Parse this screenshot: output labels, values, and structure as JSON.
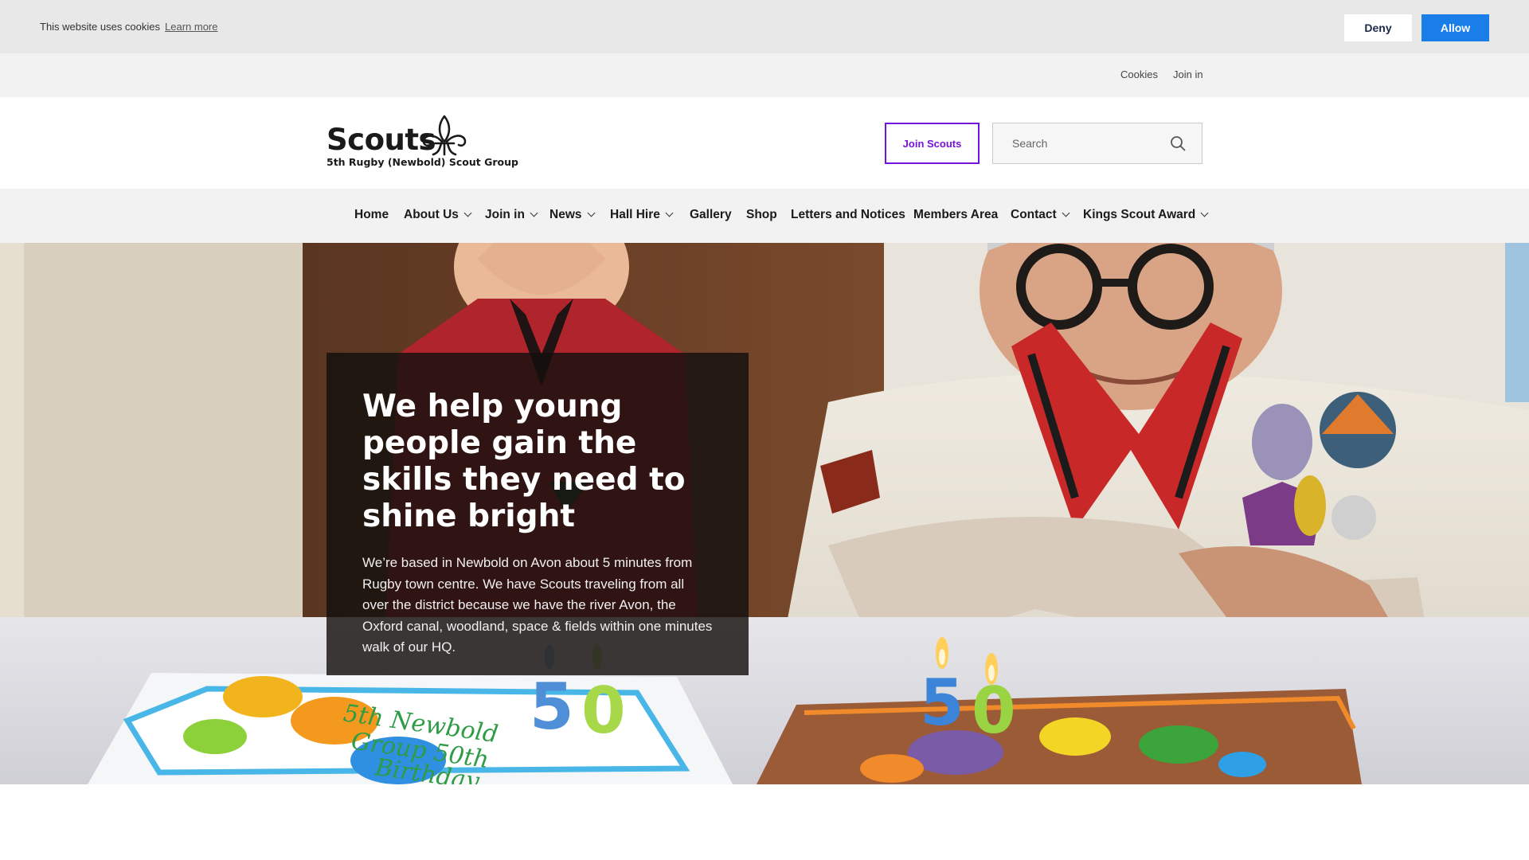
{
  "cookie_bar": {
    "message": "This website uses cookies",
    "learn_more": "Learn more",
    "deny_label": "Deny",
    "allow_label": "Allow",
    "allow_color": "#1a7ee8"
  },
  "utility_nav": {
    "items": [
      "Cookies",
      "Join in"
    ]
  },
  "header": {
    "logo_word": "Scouts",
    "logo_subtitle": "5th Rugby (Newbold) Scout Group",
    "logo_icon": "fleur-de-lis-icon",
    "join_button": "Join Scouts",
    "brand_color": "#7413dc",
    "search": {
      "placeholder": "Search",
      "value": "",
      "icon": "search-icon"
    }
  },
  "main_nav": {
    "items": [
      {
        "label": "Home",
        "dropdown": false
      },
      {
        "label": "About Us",
        "dropdown": true
      },
      {
        "label": "Join in",
        "dropdown": true
      },
      {
        "label": "News",
        "dropdown": true
      },
      {
        "label": "Hall Hire",
        "dropdown": true
      },
      {
        "label": "Gallery",
        "dropdown": false
      },
      {
        "label": "Shop",
        "dropdown": false
      },
      {
        "label": "Letters and Notices",
        "dropdown": false
      },
      {
        "label": "Members Area",
        "dropdown": false
      },
      {
        "label": "Contact",
        "dropdown": true
      },
      {
        "label": "Kings Scout Award",
        "dropdown": true
      }
    ]
  },
  "hero": {
    "title": "We help young people gain the skills they need to shine bright",
    "text": "We’re based in Newbold on Avon about 5 minutes from Rugby town centre. We have Scouts traveling from all over the district because we have the river Avon, the Oxford canal, woodland, space & fields within one minutes walk of our HQ.",
    "cake_left_text": "5th Newbold Group 50th Birthday",
    "candle_numbers": [
      "5",
      "0"
    ]
  }
}
